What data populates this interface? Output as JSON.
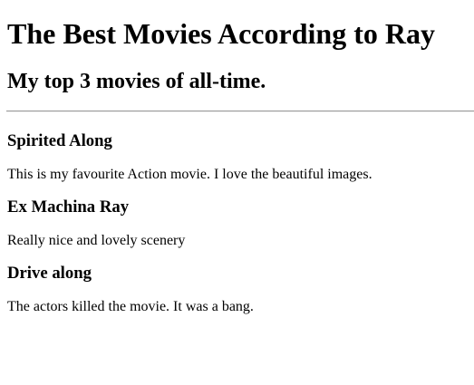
{
  "header": {
    "title": "The Best Movies According to Ray",
    "subtitle": "My top 3 movies of all-time."
  },
  "movies": [
    {
      "title": "Spirited Along",
      "description": "This is my favourite Action movie. I love the beautiful images."
    },
    {
      "title": "Ex Machina Ray",
      "description": "Really nice and lovely scenery"
    },
    {
      "title": "Drive along",
      "description": "The actors killed the movie. It was a bang."
    }
  ]
}
